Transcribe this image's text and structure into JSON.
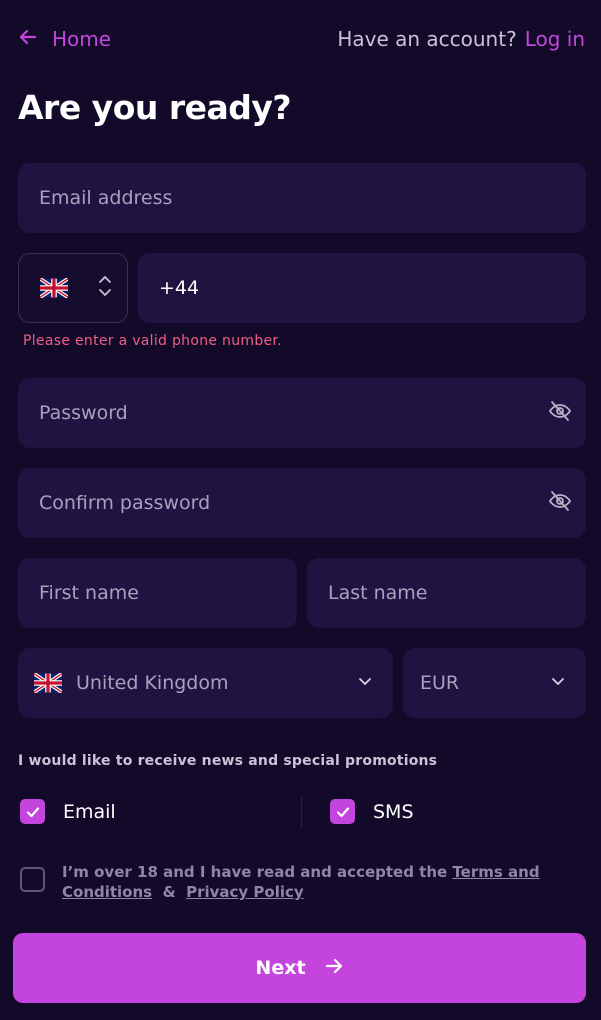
{
  "header": {
    "home_label": "Home",
    "account_question": "Have an account?",
    "login_label": "Log in"
  },
  "title": "Are you ready?",
  "form": {
    "email_placeholder": "Email address",
    "phone_country_flag": "uk-flag-icon",
    "phone_value": "+44",
    "phone_error": "Please enter a valid phone number.",
    "password_placeholder": "Password",
    "confirm_password_placeholder": "Confirm password",
    "first_name_placeholder": "First name",
    "last_name_placeholder": "Last name",
    "country_value": "United Kingdom",
    "currency_value": "EUR"
  },
  "promotions": {
    "label": "I would like to receive news and special promotions",
    "email_label": "Email",
    "email_checked": true,
    "sms_label": "SMS",
    "sms_checked": true
  },
  "terms": {
    "checked": false,
    "text_prefix": "I’m over 18 and I have read and accepted the ",
    "terms_link": "Terms and Conditions",
    "separator": "&",
    "privacy_link": "Privacy Policy"
  },
  "next_label": "Next",
  "colors": {
    "background": "#130a2a",
    "field": "#201342",
    "accent": "#c445de",
    "error": "#ee5f84"
  }
}
